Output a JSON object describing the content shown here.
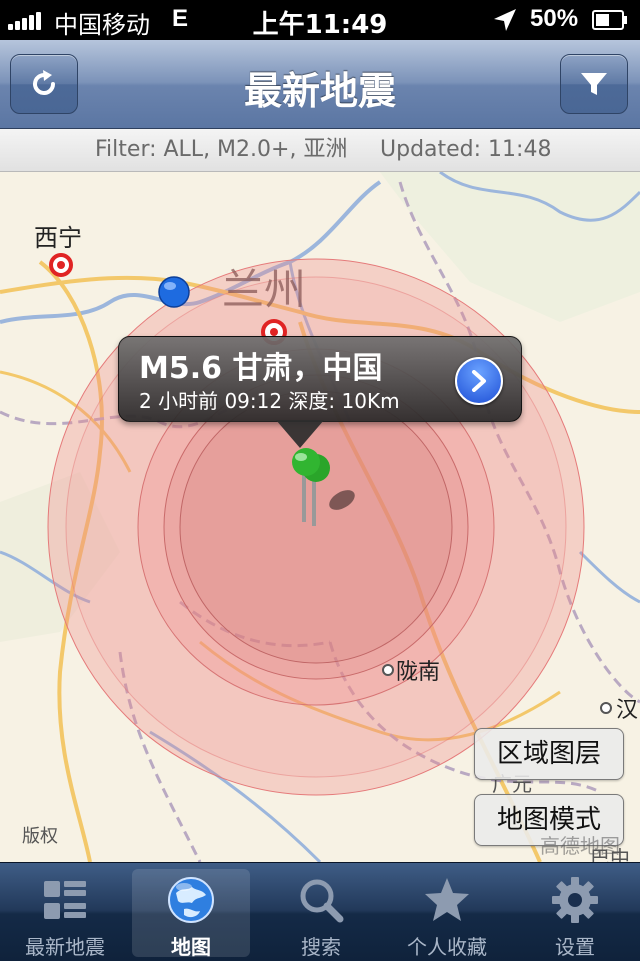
{
  "status_bar": {
    "carrier": "中国移动",
    "network": "E",
    "time": "上午11:49",
    "battery": "50%",
    "icons": [
      "signal-bars-icon",
      "location-arrow-icon",
      "battery-icon"
    ]
  },
  "nav": {
    "title": "最新地震",
    "left_icon": "refresh-icon",
    "right_icon": "filter-funnel-icon"
  },
  "filter_bar": {
    "filter": "Filter: ALL, M2.0+, 亚洲",
    "updated": "Updated: 11:48"
  },
  "map": {
    "cities": {
      "xining": "西宁",
      "lanzhou": "兰州",
      "longnan": "陇南",
      "han": "汉",
      "guangyuan": "广元",
      "bazhong": "巴中"
    },
    "callout": {
      "title": "M5.6 甘肃，中国",
      "subtitle": "2 小时前 09:12  深度: 10Km"
    },
    "layer_button": "区域图层",
    "mode_button": "地图模式",
    "copyright": "版权",
    "provider": "高德地图",
    "colors": {
      "ring": "#f08a8a",
      "pin": "#2aa52a",
      "user_dot": "#1e6be0"
    }
  },
  "tabs": [
    {
      "label": "最新地震",
      "icon": "list-icon",
      "selected": false
    },
    {
      "label": "地图",
      "icon": "globe-icon",
      "selected": true
    },
    {
      "label": "搜索",
      "icon": "search-icon",
      "selected": false
    },
    {
      "label": "个人收藏",
      "icon": "star-icon",
      "selected": false
    },
    {
      "label": "设置",
      "icon": "gear-icon",
      "selected": false
    }
  ]
}
